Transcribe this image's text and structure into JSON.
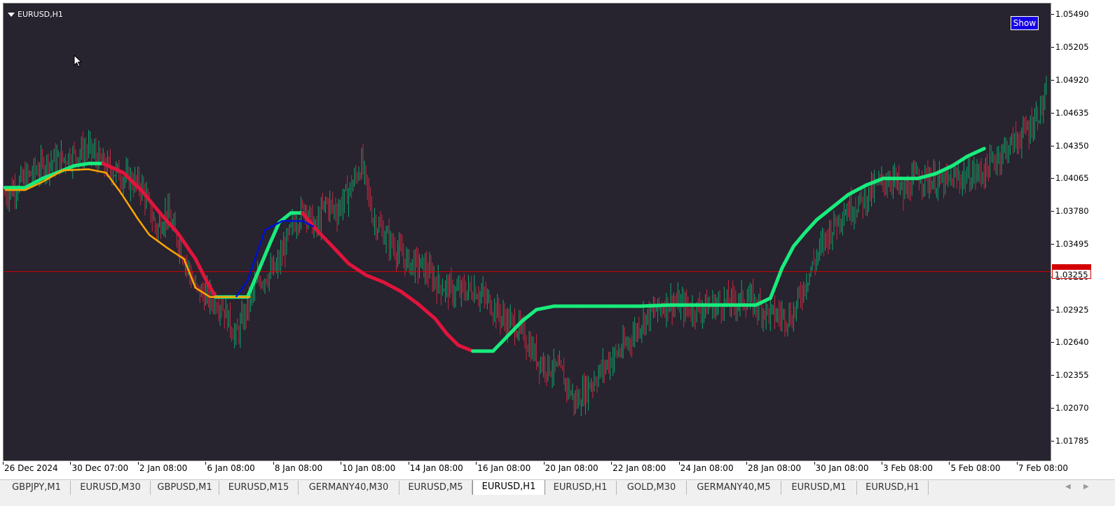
{
  "chart": {
    "symbol_label": "EURUSD,H1",
    "show_button": "Show",
    "current_price_label": "1.03255",
    "colors": {
      "background": "#27232f",
      "bull_candle": "#0ba86a",
      "bear_candle": "#c9283f",
      "up_thick": "#18ec7c",
      "down_thick": "#e0143c",
      "orange_line": "#ffa500",
      "blue_line": "#0010d0",
      "price_line": "#d40000"
    }
  },
  "chart_data": {
    "type": "line",
    "title": "EURUSD,H1",
    "ylim": [
      1.0165,
      1.0556
    ],
    "current_price": 1.0326,
    "y_ticks": [
      "1.05490",
      "1.05205",
      "1.04920",
      "1.04635",
      "1.04350",
      "1.04065",
      "1.03780",
      "1.03495",
      "1.03210",
      "1.02925",
      "1.02640",
      "1.02355",
      "1.02070",
      "1.01785"
    ],
    "x_ticks": [
      "26 Dec 2024",
      "30 Dec 07:00",
      "2 Jan 08:00",
      "6 Jan 08:00",
      "8 Jan 08:00",
      "10 Jan 08:00",
      "14 Jan 08:00",
      "16 Jan 08:00",
      "20 Jan 08:00",
      "22 Jan 08:00",
      "24 Jan 08:00",
      "28 Jan 08:00",
      "30 Jan 08:00",
      "3 Feb 08:00",
      "5 Feb 08:00",
      "7 Feb 08:00"
    ],
    "bar_count": 722,
    "close_anchors": [
      [
        0,
        1.0393
      ],
      [
        15,
        1.0408
      ],
      [
        30,
        1.0421
      ],
      [
        50,
        1.0428
      ],
      [
        58,
        1.0433
      ],
      [
        68,
        1.0419
      ],
      [
        80,
        1.041
      ],
      [
        95,
        1.04
      ],
      [
        105,
        1.0362
      ],
      [
        112,
        1.0378
      ],
      [
        125,
        1.0336
      ],
      [
        132,
        1.031
      ],
      [
        140,
        1.0305
      ],
      [
        150,
        1.0298
      ],
      [
        160,
        1.0269
      ],
      [
        175,
        1.0318
      ],
      [
        188,
        1.0328
      ],
      [
        195,
        1.0352
      ],
      [
        200,
        1.0368
      ],
      [
        208,
        1.0383
      ],
      [
        215,
        1.0362
      ],
      [
        222,
        1.0386
      ],
      [
        230,
        1.0379
      ],
      [
        240,
        1.04
      ],
      [
        247,
        1.042
      ],
      [
        255,
        1.0372
      ],
      [
        265,
        1.0354
      ],
      [
        278,
        1.0335
      ],
      [
        290,
        1.033
      ],
      [
        300,
        1.0315
      ],
      [
        312,
        1.0308
      ],
      [
        325,
        1.0311
      ],
      [
        335,
        1.03
      ],
      [
        345,
        1.0285
      ],
      [
        355,
        1.0278
      ],
      [
        370,
        1.0248
      ],
      [
        385,
        1.0238
      ],
      [
        395,
        1.0212
      ],
      [
        405,
        1.0228
      ],
      [
        418,
        1.0248
      ],
      [
        430,
        1.0262
      ],
      [
        442,
        1.0285
      ],
      [
        460,
        1.03
      ],
      [
        475,
        1.0293
      ],
      [
        495,
        1.0298
      ],
      [
        515,
        1.0302
      ],
      [
        530,
        1.0289
      ],
      [
        545,
        1.0287
      ],
      [
        555,
        1.032
      ],
      [
        568,
        1.0355
      ],
      [
        580,
        1.0378
      ],
      [
        592,
        1.0386
      ],
      [
        605,
        1.0402
      ],
      [
        615,
        1.0408
      ],
      [
        622,
        1.0392
      ],
      [
        632,
        1.041
      ],
      [
        648,
        1.0403
      ],
      [
        662,
        1.0408
      ],
      [
        678,
        1.0413
      ],
      [
        690,
        1.043
      ],
      [
        700,
        1.044
      ],
      [
        710,
        1.0452
      ],
      [
        718,
        1.047
      ],
      [
        722,
        1.0478
      ]
    ],
    "series": [
      {
        "name": "",
        "style": "thick-colored",
        "points": [
          [
            0,
            1.0399
          ],
          [
            14,
            1.0399
          ],
          [
            26,
            1.0407
          ],
          [
            38,
            1.0413
          ],
          [
            48,
            1.0418
          ],
          [
            58,
            1.042
          ],
          [
            68,
            1.042
          ],
          [
            82,
            1.0412
          ],
          [
            95,
            1.0396
          ],
          [
            108,
            1.0376
          ],
          [
            120,
            1.0359
          ],
          [
            132,
            1.0337
          ],
          [
            140,
            1.0317
          ],
          [
            146,
            1.0304
          ],
          [
            160,
            1.0304
          ],
          [
            168,
            1.0304
          ],
          [
            176,
            1.0328
          ],
          [
            184,
            1.0352
          ],
          [
            190,
            1.0369
          ],
          [
            198,
            1.0377
          ],
          [
            206,
            1.0377
          ],
          [
            216,
            1.0362
          ],
          [
            226,
            1.0349
          ],
          [
            238,
            1.0333
          ],
          [
            250,
            1.0323
          ],
          [
            262,
            1.0317
          ],
          [
            274,
            1.0309
          ],
          [
            286,
            1.0298
          ],
          [
            298,
            1.0285
          ],
          [
            306,
            1.0272
          ],
          [
            314,
            1.0262
          ],
          [
            324,
            1.0257
          ],
          [
            338,
            1.0257
          ],
          [
            348,
            1.027
          ],
          [
            358,
            1.0283
          ],
          [
            368,
            1.0293
          ],
          [
            380,
            1.0296
          ],
          [
            400,
            1.0296
          ],
          [
            420,
            1.0296
          ],
          [
            440,
            1.0296
          ],
          [
            460,
            1.0297
          ],
          [
            480,
            1.0297
          ],
          [
            500,
            1.0297
          ],
          [
            520,
            1.0297
          ],
          [
            530,
            1.0303
          ],
          [
            538,
            1.0329
          ],
          [
            546,
            1.0348
          ],
          [
            554,
            1.036
          ],
          [
            562,
            1.0371
          ],
          [
            572,
            1.0381
          ],
          [
            584,
            1.0393
          ],
          [
            596,
            1.0401
          ],
          [
            608,
            1.0407
          ],
          [
            620,
            1.0407
          ],
          [
            632,
            1.0407
          ],
          [
            644,
            1.0411
          ],
          [
            656,
            1.0418
          ],
          [
            666,
            1.0426
          ],
          [
            678,
            1.0433
          ]
        ]
      },
      {
        "name": "",
        "style": "orange",
        "points": [
          [
            0,
            1.0397
          ],
          [
            14,
            1.0397
          ],
          [
            26,
            1.0404
          ],
          [
            40,
            1.0414
          ],
          [
            58,
            1.0415
          ],
          [
            70,
            1.0412
          ],
          [
            80,
            1.0395
          ],
          [
            92,
            1.0372
          ],
          [
            100,
            1.0358
          ],
          [
            112,
            1.0347
          ],
          [
            124,
            1.0337
          ],
          [
            132,
            1.0312
          ],
          [
            142,
            1.0304
          ],
          [
            156,
            1.0304
          ],
          [
            170,
            1.0304
          ]
        ]
      },
      {
        "name": "",
        "style": "blue",
        "points": [
          [
            160,
            1.0304
          ],
          [
            168,
            1.0318
          ],
          [
            180,
            1.0362
          ],
          [
            192,
            1.037
          ],
          [
            206,
            1.037
          ],
          [
            214,
            1.0365
          ]
        ]
      }
    ]
  },
  "tabs": [
    "GBPJPY,M1",
    "EURUSD,M30",
    "GBPUSD,M1",
    "EURUSD,M15",
    "GERMANY40,M30",
    "EURUSD,M5",
    "EURUSD,H1",
    "EURUSD,H1",
    "GOLD,M30",
    "GERMANY40,M5",
    "EURUSD,M1",
    "EURUSD,H1"
  ],
  "active_tab": "EURUSD,H1"
}
